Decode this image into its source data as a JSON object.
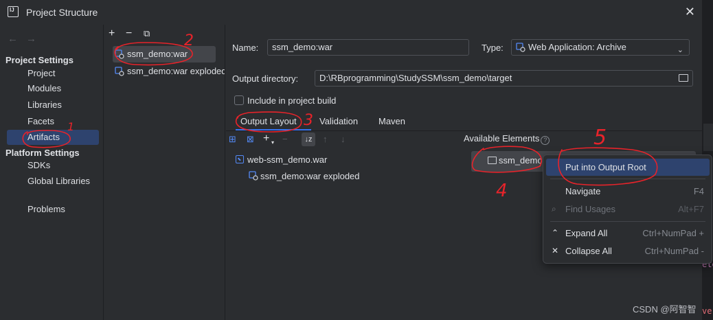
{
  "window": {
    "title": "Project Structure"
  },
  "nav": {
    "project_settings_header": "Project Settings",
    "project_settings": [
      "Project",
      "Modules",
      "Libraries",
      "Facets",
      "Artifacts"
    ],
    "platform_settings_header": "Platform Settings",
    "platform_settings": [
      "SDKs",
      "Global Libraries"
    ],
    "problems": "Problems",
    "selected": "Artifacts"
  },
  "artifacts": {
    "items": [
      "ssm_demo:war",
      "ssm_demo:war exploded"
    ],
    "selected": "ssm_demo:war"
  },
  "form": {
    "name_label": "Name:",
    "name_value": "ssm_demo:war",
    "type_label": "Type:",
    "type_value": "Web Application: Archive",
    "output_dir_label": "Output directory:",
    "output_dir_value": "D:\\RBprogramming\\StudySSM\\ssm_demo\\target",
    "include_label": "Include in project build",
    "include_checked": false
  },
  "tabs": [
    "Output Layout",
    "Validation",
    "Maven"
  ],
  "active_tab": "Output Layout",
  "layout_tree": {
    "root": "web-ssm_demo.war",
    "child": "ssm_demo:war exploded"
  },
  "available": {
    "header": "Available Elements",
    "item": "ssm_demo"
  },
  "context_menu": {
    "items": [
      {
        "label": "Put into Output Root",
        "shortcut": "",
        "selected": true,
        "disabled": false
      },
      {
        "label": "Navigate",
        "shortcut": "F4",
        "selected": false,
        "disabled": false
      },
      {
        "label": "Find Usages",
        "shortcut": "Alt+F7",
        "selected": false,
        "disabled": true
      },
      {
        "label": "Expand All",
        "shortcut": "Ctrl+NumPad +",
        "selected": false,
        "disabled": false
      },
      {
        "label": "Collapse All",
        "shortcut": "Ctrl+NumPad -",
        "selected": false,
        "disabled": false
      }
    ]
  },
  "annotations": [
    "1",
    "2",
    "3",
    "4",
    "5"
  ],
  "edge_text": [
    "ete",
    "ve"
  ],
  "watermark": "CSDN @阿智智",
  "colors": {
    "selection": "#2e436e",
    "accent": "#3574f0",
    "annotation": "#e8232a"
  }
}
